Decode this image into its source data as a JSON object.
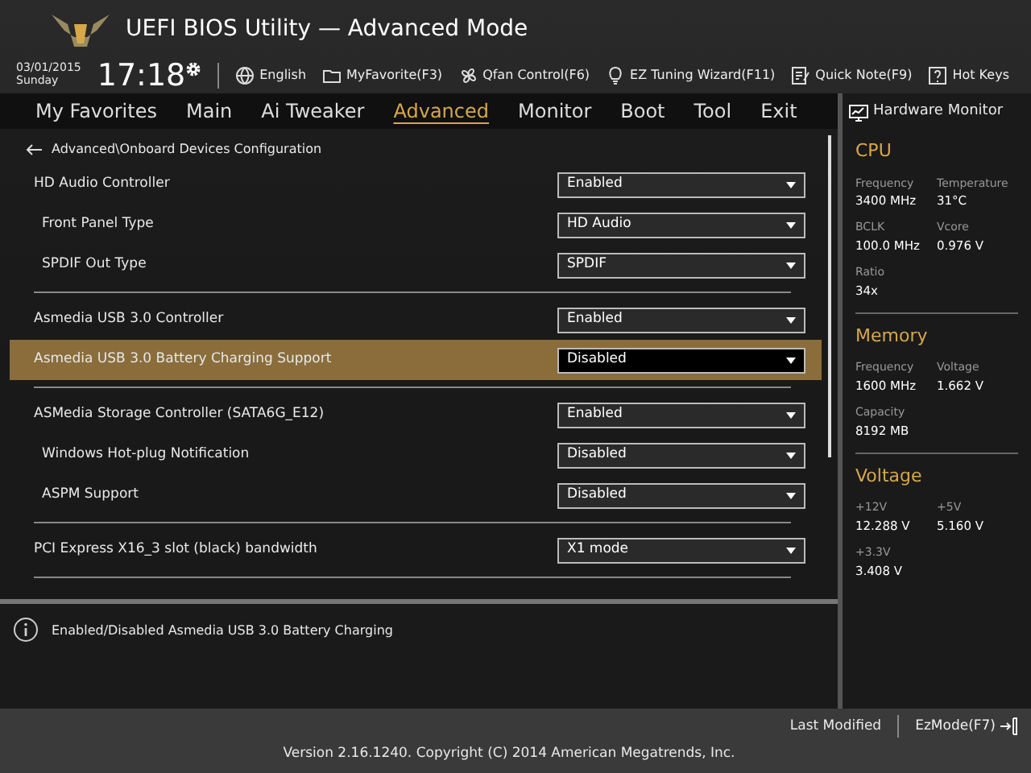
{
  "header": {
    "title": "UEFI BIOS Utility — Advanced Mode",
    "date": "03/01/2015",
    "day": "Sunday",
    "time": "17:18"
  },
  "toolbar": [
    {
      "label": "English"
    },
    {
      "label": "MyFavorite(F3)"
    },
    {
      "label": "Qfan Control(F6)"
    },
    {
      "label": "EZ Tuning Wizard(F11)"
    },
    {
      "label": "Quick Note(F9)"
    },
    {
      "label": "Hot Keys"
    }
  ],
  "tabs": [
    {
      "label": "My Favorites",
      "selected": false
    },
    {
      "label": "Main",
      "selected": false
    },
    {
      "label": "Ai Tweaker",
      "selected": false
    },
    {
      "label": "Advanced",
      "selected": true
    },
    {
      "label": "Monitor",
      "selected": false
    },
    {
      "label": "Boot",
      "selected": false
    },
    {
      "label": "Tool",
      "selected": false
    },
    {
      "label": "Exit",
      "selected": false
    }
  ],
  "breadcrumb": "Advanced\\Onboard Devices Configuration",
  "groups": [
    [
      {
        "label": "HD Audio Controller",
        "value": "Enabled",
        "selected": false,
        "children": [
          {
            "label": "Front Panel Type",
            "value": "HD Audio",
            "selected": false
          },
          {
            "label": "SPDIF Out Type",
            "value": "SPDIF",
            "selected": false
          }
        ]
      }
    ],
    [
      {
        "label": "Asmedia USB 3.0 Controller",
        "value": "Enabled",
        "selected": false
      },
      {
        "label": "Asmedia USB 3.0 Battery Charging Support",
        "value": "Disabled",
        "selected": true
      }
    ],
    [
      {
        "label": "ASMedia Storage Controller (SATA6G_E12)",
        "value": "Enabled",
        "selected": false,
        "children": [
          {
            "label": "Windows Hot-plug Notification",
            "value": "Disabled",
            "selected": false
          },
          {
            "label": "ASPM Support",
            "value": "Disabled",
            "selected": false
          }
        ]
      }
    ],
    [
      {
        "label": "PCI Express X16_3 slot (black) bandwidth",
        "value": "X1 mode",
        "selected": false
      }
    ]
  ],
  "help": "Enabled/Disabled Asmedia USB 3.0 Battery Charging",
  "hardware_monitor": {
    "title": "Hardware Monitor",
    "sections": [
      {
        "title": "CPU",
        "items": [
          {
            "label": "Frequency",
            "value": "3400 MHz"
          },
          {
            "label": "Temperature",
            "value": "31°C"
          },
          {
            "label": "BCLK",
            "value": "100.0 MHz"
          },
          {
            "label": "Vcore",
            "value": "0.976 V"
          },
          {
            "label": "Ratio",
            "value": "34x"
          }
        ]
      },
      {
        "title": "Memory",
        "items": [
          {
            "label": "Frequency",
            "value": "1600 MHz"
          },
          {
            "label": "Voltage",
            "value": "1.662 V"
          },
          {
            "label": "Capacity",
            "value": "8192 MB"
          }
        ]
      },
      {
        "title": "Voltage",
        "items": [
          {
            "label": "+12V",
            "value": "12.288 V"
          },
          {
            "label": "+5V",
            "value": "5.160 V"
          },
          {
            "label": "+3.3V",
            "value": "3.408 V"
          }
        ]
      }
    ]
  },
  "footer": {
    "last_modified": "Last Modified",
    "ezmode": "EzMode(F7)",
    "version": "Version 2.16.1240. Copyright (C) 2014 American Megatrends, Inc."
  }
}
